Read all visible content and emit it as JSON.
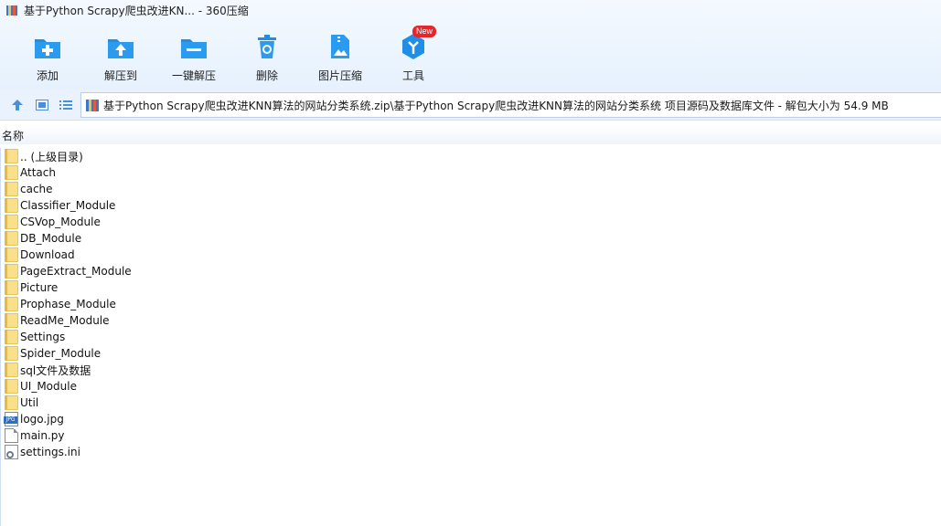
{
  "window": {
    "title": "基于Python Scrapy爬虫改进KN... - 360压缩"
  },
  "toolbar": {
    "buttons": [
      {
        "label": "添加",
        "icon": "add-icon"
      },
      {
        "label": "解压到",
        "icon": "extract-to-icon"
      },
      {
        "label": "一键解压",
        "icon": "one-click-extract-icon"
      },
      {
        "label": "删除",
        "icon": "delete-icon"
      },
      {
        "label": "图片压缩",
        "icon": "image-compress-icon"
      },
      {
        "label": "工具",
        "icon": "tools-icon",
        "badge": "New"
      }
    ]
  },
  "address": {
    "path": "基于Python Scrapy爬虫改进KNN算法的网站分类系统.zip\\基于Python Scrapy爬虫改进KNN算法的网站分类系统 项目源码及数据库文件 - 解包大小为 54.9 MB"
  },
  "columns": {
    "name": "名称"
  },
  "files": [
    {
      "name": ".. (上级目录)",
      "type": "folder"
    },
    {
      "name": "Attach",
      "type": "folder"
    },
    {
      "name": "cache",
      "type": "folder"
    },
    {
      "name": "Classifier_Module",
      "type": "folder"
    },
    {
      "name": "CSVop_Module",
      "type": "folder"
    },
    {
      "name": "DB_Module",
      "type": "folder"
    },
    {
      "name": "Download",
      "type": "folder"
    },
    {
      "name": "PageExtract_Module",
      "type": "folder"
    },
    {
      "name": "Picture",
      "type": "folder"
    },
    {
      "name": "Prophase_Module",
      "type": "folder"
    },
    {
      "name": "ReadMe_Module",
      "type": "folder"
    },
    {
      "name": "Settings",
      "type": "folder"
    },
    {
      "name": "Spider_Module",
      "type": "folder"
    },
    {
      "name": "sql文件及数据",
      "type": "folder"
    },
    {
      "name": "UI_Module",
      "type": "folder"
    },
    {
      "name": "Util",
      "type": "folder"
    },
    {
      "name": "logo.jpg",
      "type": "jpg"
    },
    {
      "name": "main.py",
      "type": "doc"
    },
    {
      "name": "settings.ini",
      "type": "ini"
    }
  ],
  "colors": {
    "accent": "#1e8ee6",
    "folder": "#fbe08c",
    "badge": "#e8252a"
  }
}
